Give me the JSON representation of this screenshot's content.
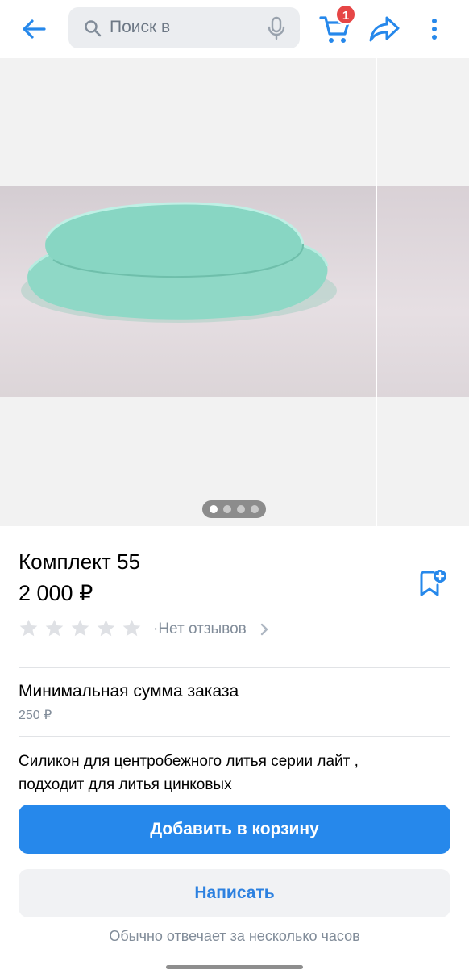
{
  "header": {
    "search_placeholder": "Поиск в",
    "cart_count": "1",
    "icons": [
      "arrow-left-icon",
      "search-icon",
      "microphone-icon",
      "cart-icon",
      "share-icon",
      "more-vertical-icon"
    ],
    "accent_color": "#2688eb",
    "badge_color": "#e64646"
  },
  "gallery": {
    "image_count": 4,
    "active_index": 0
  },
  "product": {
    "title": "Комплект 55",
    "price": "2 000 ₽",
    "rating_stars": 0,
    "reviews_label": "·Нет отзывов",
    "min_order_label": "Минимальная сумма заказа",
    "min_order_value": "250 ₽",
    "description_line1": "Силикон для центробежного литья серии лайт ,",
    "description_line2": "подходит для литья цинковых"
  },
  "actions": {
    "add_to_cart": "Добавить в корзину",
    "write": "Написать",
    "reply_note": "Обычно отвечает за несколько часов"
  }
}
